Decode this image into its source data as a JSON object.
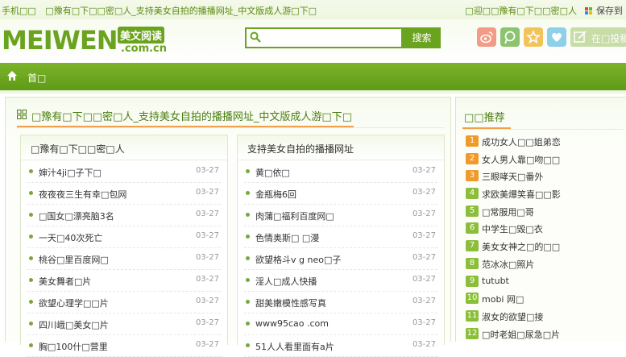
{
  "topbar": {
    "left_items": [
      "手机□□",
      "□豫有□下□□密□人_支持美女自拍的播播网址_中文版成人游□下□"
    ],
    "right_text": "□迎□□豫有□下□□密□人",
    "save_label": "保存到"
  },
  "header": {
    "logo_text": "MEIWEN",
    "logo_cn": "美文阅读",
    "logo_domain": ".com.cn",
    "search": {
      "value": "",
      "placeholder": "",
      "button_label": "搜索"
    },
    "login_label": "在□投稿"
  },
  "nav": {
    "home_label": "首□"
  },
  "main": {
    "title": "□豫有□下□□密□人_支持美女自拍的播播网址_中文版成人游□下□",
    "columns": [
      {
        "title": "□豫有□下□□密□人",
        "items": [
          {
            "text": "婶汁4ji□子下□",
            "date": "03-27"
          },
          {
            "text": "夜夜夜三生有幸□包网",
            "date": "03-27"
          },
          {
            "text": "□国女□漂亮脑3名",
            "date": "03-27"
          },
          {
            "text": "一天□40次死亡",
            "date": "03-27"
          },
          {
            "text": "桃谷□里百度网□",
            "date": "03-27"
          },
          {
            "text": "美女舞者□片",
            "date": "03-27"
          },
          {
            "text": "欲望心理学□□片",
            "date": "03-27"
          },
          {
            "text": "四川峨□美女□片",
            "date": "03-27"
          },
          {
            "text": "胸□100什□营里",
            "date": "03-27"
          }
        ]
      },
      {
        "title": "支持美女自拍的播播网址",
        "items": [
          {
            "text": "黄□依□",
            "date": "03-27"
          },
          {
            "text": "金瓶梅6回",
            "date": "03-27"
          },
          {
            "text": "肉蒲□福利百度网□",
            "date": "03-27"
          },
          {
            "text": "色情奥斯□ □漫",
            "date": "03-27"
          },
          {
            "text": "欲望格斗v g neo□子",
            "date": "03-27"
          },
          {
            "text": "淫人□成人快播",
            "date": "03-27"
          },
          {
            "text": "甜美嫩模性感写真",
            "date": "03-27"
          },
          {
            "text": "www95cao .com",
            "date": "03-27"
          },
          {
            "text": "51人人看里面有a片",
            "date": "03-27"
          }
        ]
      }
    ]
  },
  "side": {
    "title": "□□推荐",
    "items": [
      {
        "num": "1",
        "text": "成功女人□□姐弟恋",
        "color": "orange"
      },
      {
        "num": "2",
        "text": "女人男人靠□吻□□",
        "color": "orange"
      },
      {
        "num": "3",
        "text": "三眼哮天□番外",
        "color": "orange"
      },
      {
        "num": "4",
        "text": "求欧美爆笑喜□□影",
        "color": "green"
      },
      {
        "num": "5",
        "text": "□常服用□哥",
        "color": "green"
      },
      {
        "num": "6",
        "text": "中学生□毁□衣",
        "color": "green"
      },
      {
        "num": "7",
        "text": "美女女神之□的□□",
        "color": "green"
      },
      {
        "num": "8",
        "text": "范冰冰□照片",
        "color": "green"
      },
      {
        "num": "9",
        "text": "tutubt",
        "color": "green"
      },
      {
        "num": "10",
        "text": "mobi 网□",
        "color": "green"
      },
      {
        "num": "11",
        "text": "淑女的欲望□接",
        "color": "green"
      },
      {
        "num": "12",
        "text": "□时老姐□尿急□片",
        "color": "green"
      }
    ]
  },
  "colors": {
    "brand": "#6aa31d",
    "accent": "#f2a14a"
  }
}
